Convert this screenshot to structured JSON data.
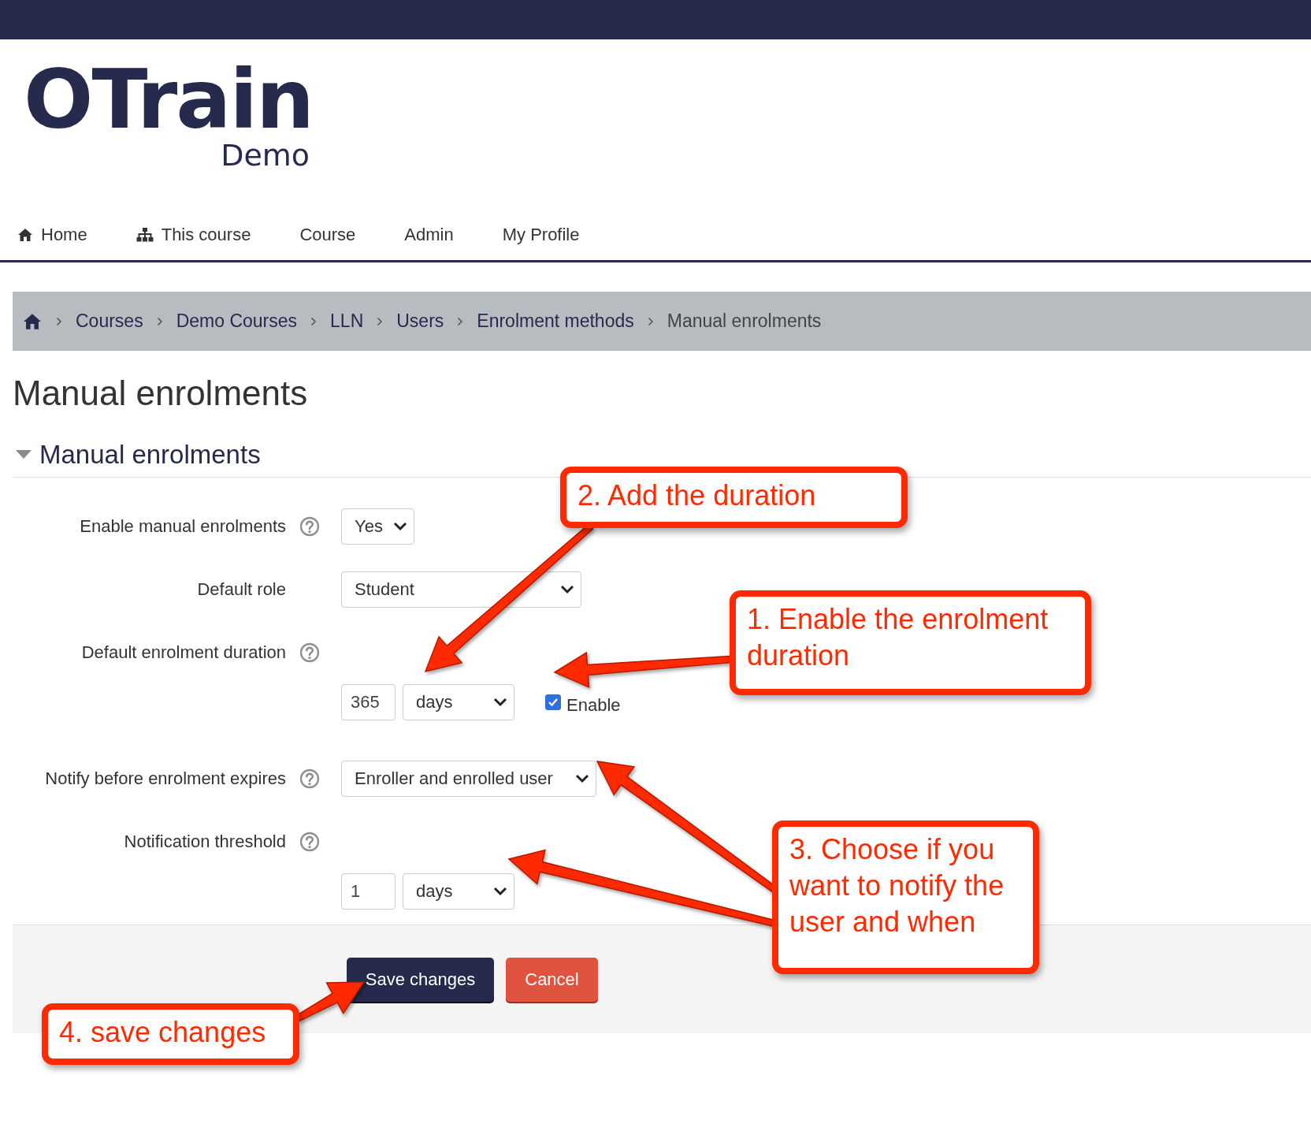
{
  "logo": {
    "text": "OTrain",
    "subtitle": "Demo"
  },
  "nav": [
    {
      "label": "Home"
    },
    {
      "label": "This course"
    },
    {
      "label": "Course"
    },
    {
      "label": "Admin"
    },
    {
      "label": "My Profile"
    }
  ],
  "breadcrumb": [
    {
      "label": "Courses"
    },
    {
      "label": "Demo Courses"
    },
    {
      "label": "LLN"
    },
    {
      "label": "Users"
    },
    {
      "label": "Enrolment methods"
    },
    {
      "label": "Manual enrolments"
    }
  ],
  "page_title": "Manual enrolments",
  "section": {
    "title": "Manual enrolments",
    "expanded": true
  },
  "form": [
    {
      "label": "Enable manual enrolments",
      "help": true,
      "kind": "select",
      "value": "Yes"
    },
    {
      "label": "Default role",
      "help": false,
      "kind": "select",
      "value": "Student"
    },
    {
      "label": "Default enrolment duration",
      "help": true,
      "kind": "duration",
      "number": "365",
      "unit": "days",
      "enable": {
        "label": "Enable",
        "checked": true
      }
    },
    {
      "label": "Notify before enrolment expires",
      "help": true,
      "kind": "select",
      "value": "Enroller and enrolled user"
    },
    {
      "label": "Notification threshold",
      "help": true,
      "kind": "duration",
      "number": "1",
      "unit": "days"
    }
  ],
  "buttons": [
    {
      "label": "Save changes",
      "kind": "primary"
    },
    {
      "label": "Cancel",
      "kind": "danger"
    }
  ],
  "callouts": [
    {
      "text": "2. Add the duration"
    },
    {
      "text": "1. Enable the enrolment duration"
    },
    {
      "text": "3. Choose if you want to notify the user and when"
    },
    {
      "text": "4. save changes"
    }
  ]
}
